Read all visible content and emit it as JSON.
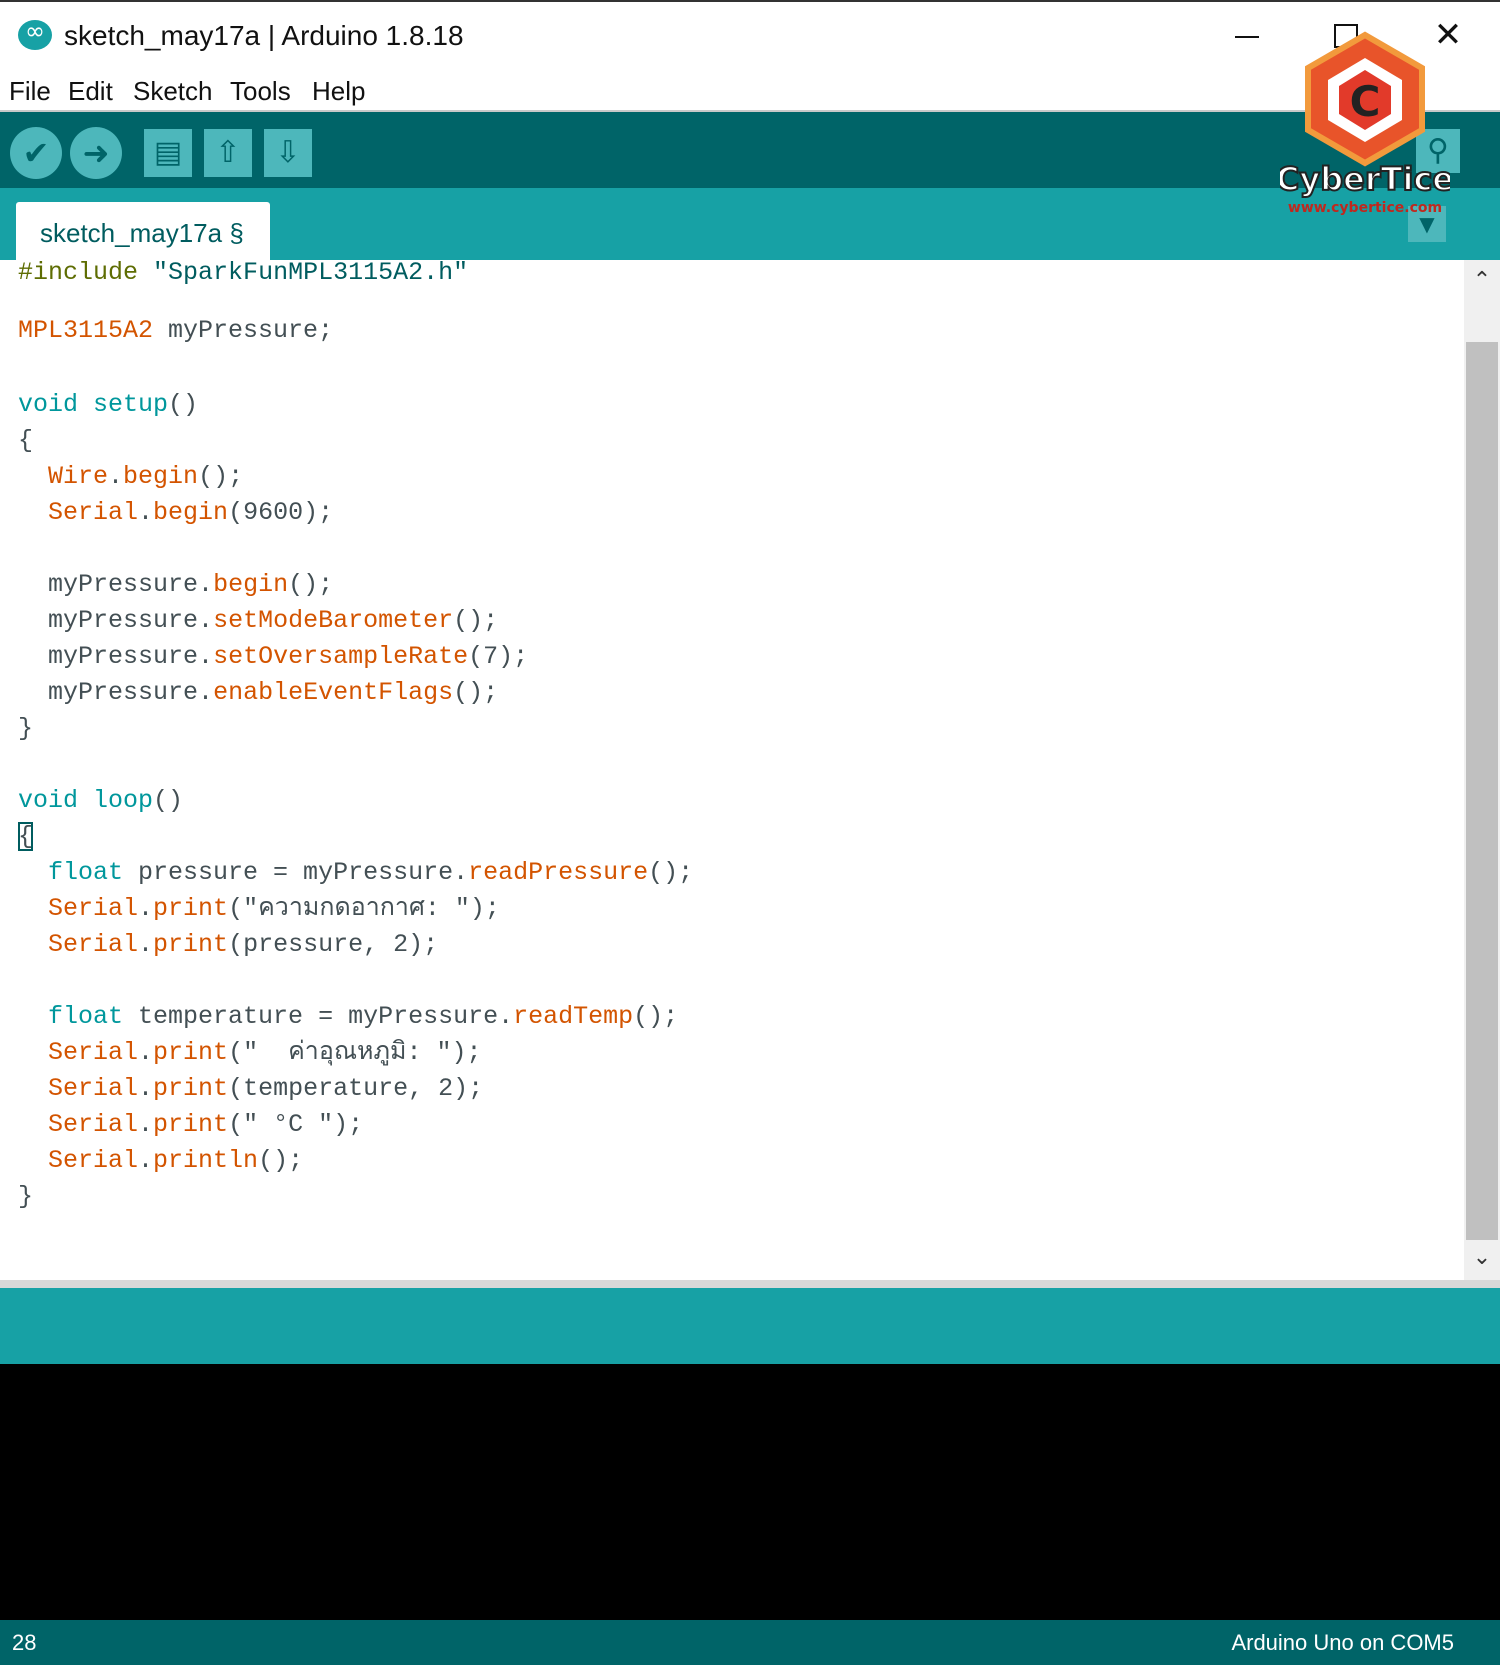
{
  "window": {
    "title": "sketch_may17a | Arduino 1.8.18",
    "minimize_icon": "minimize-icon",
    "maximize_icon": "maximize-icon",
    "close_glyph": "✕"
  },
  "menu": [
    "File",
    "Edit",
    "Sketch",
    "Tools",
    "Help"
  ],
  "toolbar": {
    "verify_glyph": "✔",
    "upload_glyph": "➜",
    "new_glyph": "▤",
    "open_glyph": "⇧",
    "save_glyph": "⇩",
    "serial_monitor_glyph": "⚲"
  },
  "tab": {
    "label": "sketch_may17a §",
    "menu_glyph": "▼"
  },
  "logo": {
    "name": "CyberTice",
    "url": "www.cybertice.com",
    "letter": "C"
  },
  "code": {
    "l1_pre": "#include",
    "l1_str": "\"SparkFunMPL3115A2.h\"",
    "l3_class": "MPL3115A2",
    "l3_rest": " myPressure;",
    "void": "void",
    "setup": "setup",
    "paren": "()",
    "open": "{",
    "close": "}",
    "wire": "Wire",
    "serial": "Serial",
    "dot": ".",
    "begin": "begin",
    "call_end": "();",
    "baud_args": "(9600);",
    "mypressure": "myPressure",
    "setModeBarometer": "setModeBarometer",
    "setOversampleRate": "setOversampleRate",
    "oversample_args": "(7);",
    "enableEventFlags": "enableEventFlags",
    "loop": "loop",
    "float": "float",
    "pressure_decl": " pressure = myPressure.",
    "readPressure": "readPressure",
    "print": "print",
    "println": "println",
    "print_pressure_label": "(\"ความกดอากาศ: \");",
    "print_pressure_val": "(pressure, 2);",
    "temp_decl": " temperature = myPressure.",
    "readTemp": "readTemp",
    "print_temp_label": "(\"  ค่าอุณหภูมิ: \");",
    "print_temp_val": "(temperature, 2);",
    "print_unit": "(\" °C \");"
  },
  "scroll": {
    "up_glyph": "⌃",
    "down_glyph": "⌄",
    "thumb_fraction": 0.93
  },
  "footer": {
    "line_number": "28",
    "board": "Arduino Uno on COM5"
  },
  "colors": {
    "toolbar": "#006468",
    "tabbar": "#17a1a5",
    "keyword_type": "#00979c",
    "keyword_function": "#d35400",
    "string": "#005c5f",
    "console": "#000000"
  }
}
